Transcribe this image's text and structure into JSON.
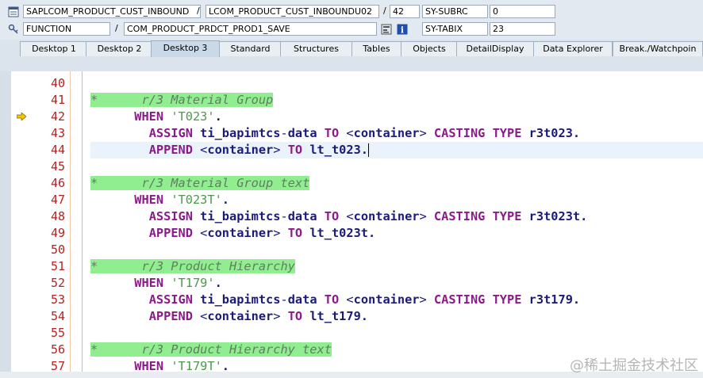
{
  "header": {
    "row1": {
      "program": "SAPLCOM_PRODUCT_CUST_INBOUND",
      "include": "LCOM_PRODUCT_CUST_INBOUNDU02",
      "line": "42",
      "var_name": "SY-SUBRC",
      "var_value": "0"
    },
    "row2": {
      "event_type": "FUNCTION",
      "event_name": "COM_PRODUCT_PRDCT_PROD1_SAVE",
      "var_name": "SY-TABIX",
      "var_value": "23"
    },
    "separator": "/"
  },
  "tabs": [
    {
      "label": "Desktop 1"
    },
    {
      "label": "Desktop 2"
    },
    {
      "label": "Desktop 3",
      "active": true
    },
    {
      "label": "Standard"
    },
    {
      "label": "Structures"
    },
    {
      "label": "Tables"
    },
    {
      "label": "Objects"
    },
    {
      "label": "DetailDisplay"
    },
    {
      "label": "Data Explorer"
    },
    {
      "label": "Break./Watchpoin"
    }
  ],
  "code_lines": [
    {
      "num": "40",
      "tokens": []
    },
    {
      "num": "41",
      "comment": "*      r/3 Material Group"
    },
    {
      "num": "42",
      "tokens": [
        [
          "kw",
          "WHEN "
        ],
        [
          "str",
          "'T023'"
        ],
        [
          "pt",
          "."
        ]
      ],
      "indent": "      ",
      "breakpoint": true
    },
    {
      "num": "43",
      "tokens": [
        [
          "kw",
          "ASSIGN "
        ],
        [
          "id",
          "ti_bapimtcs"
        ],
        [
          "op",
          "-"
        ],
        [
          "id",
          "data "
        ],
        [
          "kw",
          "TO "
        ],
        [
          "op",
          "<"
        ],
        [
          "id",
          "container"
        ],
        [
          "op",
          "> "
        ],
        [
          "kw",
          "CASTING TYPE "
        ],
        [
          "id",
          "r3t023."
        ]
      ],
      "indent": "        "
    },
    {
      "num": "44",
      "tokens": [
        [
          "kw",
          "APPEND "
        ],
        [
          "op",
          "<"
        ],
        [
          "id",
          "container"
        ],
        [
          "op",
          "> "
        ],
        [
          "kw",
          "TO "
        ],
        [
          "id",
          "lt_t023."
        ]
      ],
      "indent": "        ",
      "current": true
    },
    {
      "num": "45",
      "tokens": []
    },
    {
      "num": "46",
      "comment": "*      r/3 Material Group text"
    },
    {
      "num": "47",
      "tokens": [
        [
          "kw",
          "WHEN "
        ],
        [
          "str",
          "'T023T'"
        ],
        [
          "pt",
          "."
        ]
      ],
      "indent": "      "
    },
    {
      "num": "48",
      "tokens": [
        [
          "kw",
          "ASSIGN "
        ],
        [
          "id",
          "ti_bapimtcs"
        ],
        [
          "op",
          "-"
        ],
        [
          "id",
          "data "
        ],
        [
          "kw",
          "TO "
        ],
        [
          "op",
          "<"
        ],
        [
          "id",
          "container"
        ],
        [
          "op",
          "> "
        ],
        [
          "kw",
          "CASTING TYPE "
        ],
        [
          "id",
          "r3t023t."
        ]
      ],
      "indent": "        "
    },
    {
      "num": "49",
      "tokens": [
        [
          "kw",
          "APPEND "
        ],
        [
          "op",
          "<"
        ],
        [
          "id",
          "container"
        ],
        [
          "op",
          "> "
        ],
        [
          "kw",
          "TO "
        ],
        [
          "id",
          "lt_t023t."
        ]
      ],
      "indent": "        "
    },
    {
      "num": "50",
      "tokens": []
    },
    {
      "num": "51",
      "comment": "*      r/3 Product Hierarchy"
    },
    {
      "num": "52",
      "tokens": [
        [
          "kw",
          "WHEN "
        ],
        [
          "str",
          "'T179'"
        ],
        [
          "pt",
          "."
        ]
      ],
      "indent": "      "
    },
    {
      "num": "53",
      "tokens": [
        [
          "kw",
          "ASSIGN "
        ],
        [
          "id",
          "ti_bapimtcs"
        ],
        [
          "op",
          "-"
        ],
        [
          "id",
          "data "
        ],
        [
          "kw",
          "TO "
        ],
        [
          "op",
          "<"
        ],
        [
          "id",
          "container"
        ],
        [
          "op",
          "> "
        ],
        [
          "kw",
          "CASTING TYPE "
        ],
        [
          "id",
          "r3t179."
        ]
      ],
      "indent": "        "
    },
    {
      "num": "54",
      "tokens": [
        [
          "kw",
          "APPEND "
        ],
        [
          "op",
          "<"
        ],
        [
          "id",
          "container"
        ],
        [
          "op",
          "> "
        ],
        [
          "kw",
          "TO "
        ],
        [
          "id",
          "lt_t179."
        ]
      ],
      "indent": "        "
    },
    {
      "num": "55",
      "tokens": []
    },
    {
      "num": "56",
      "comment": "*      r/3 Product Hierarchy text"
    },
    {
      "num": "57",
      "tokens": [
        [
          "kw",
          "WHEN "
        ],
        [
          "str",
          "'T179T'"
        ],
        [
          "pt",
          "."
        ]
      ],
      "indent": "      "
    }
  ],
  "watermark": "@稀土掘金技术社区",
  "colors": {
    "keyword": "#8b1a8b",
    "string": "#4a9a4a",
    "comment_bg": "#90ee90",
    "line_number": "#b22222"
  },
  "icons": {
    "program_icon": "document-icon",
    "event_icon": "key-icon",
    "info_icon": "info-icon",
    "breakpoint_icon": "arrow-right-icon"
  }
}
